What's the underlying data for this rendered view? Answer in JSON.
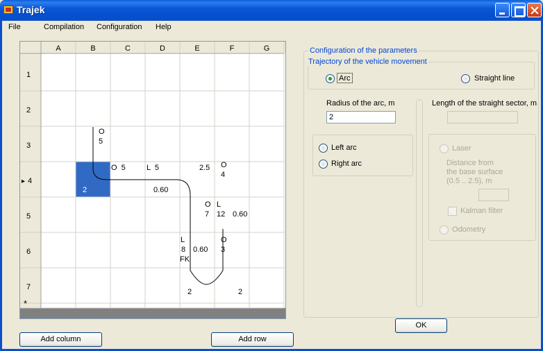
{
  "window": {
    "title": "Trajek"
  },
  "menu": {
    "items": [
      "File",
      "Compilation",
      "Configuration",
      "Help"
    ]
  },
  "grid": {
    "columns": [
      "A",
      "B",
      "C",
      "D",
      "E",
      "F",
      "G"
    ],
    "rows": [
      "1",
      "2",
      "3",
      "4",
      "5",
      "6",
      "7",
      "*"
    ],
    "current_row_marker": "▸",
    "cells": {
      "B3": [
        "O",
        "5"
      ],
      "B4": [
        "2"
      ],
      "C4": [
        "O  5"
      ],
      "D4": [
        "L  5",
        "0.60"
      ],
      "E4": [
        "2.5"
      ],
      "F4": [
        "O",
        "4"
      ],
      "F5": [
        "O",
        "7"
      ],
      "F5b": [
        "L",
        "12"
      ],
      "G5": [
        "0.60"
      ],
      "E6": [
        "L",
        "8",
        "FK"
      ],
      "E6b": [
        "0.60"
      ],
      "F6": [
        "O",
        "3"
      ],
      "E7": [
        "2"
      ],
      "F7": [
        "2"
      ]
    }
  },
  "buttons": {
    "add_column": "Add column",
    "add_row": "Add row",
    "ok": "OK"
  },
  "config": {
    "group_title": "Configuration of the parameters",
    "trajectory_title": "Trajectory of the vehicle movement",
    "arc_label": "Arc",
    "straight_label": "Straight line",
    "radius_label": "Radius of the arc, m",
    "radius_value": "2",
    "length_label": "Length of the straight sector, m",
    "length_value": "",
    "left_arc": "Left arc",
    "right_arc": "Right arc",
    "laser": "Laser",
    "distance_label_1": "Distance from",
    "distance_label_2": "the base surface",
    "distance_label_3": "(0.5 .. 2.5), m",
    "distance_value": "",
    "kalman": "Kalman filter",
    "odometry": "Odometry"
  }
}
